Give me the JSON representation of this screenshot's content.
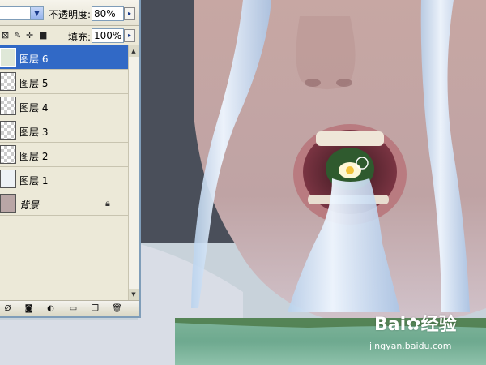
{
  "colors": {
    "panel_bg": "#ece9d8",
    "selection": "#3169c6",
    "xp_border": "#7f9db9",
    "water": "#dcecff",
    "skin": "#c9a9a2"
  },
  "options_bar": {
    "opacity_label": "不透明度:",
    "opacity_value": "80%",
    "fill_label": "填充:",
    "fill_value": "100%"
  },
  "lock_icons": [
    "transparency-lock-icon",
    "brush-lock-icon",
    "move-lock-icon",
    "all-lock-icon"
  ],
  "layers": [
    {
      "label": "图层 6",
      "selected": true
    },
    {
      "label": "图层 5",
      "selected": false
    },
    {
      "label": "图层 4",
      "selected": false
    },
    {
      "label": "图层 3",
      "selected": false
    },
    {
      "label": "图层 2",
      "selected": false
    },
    {
      "label": "图层 1",
      "selected": false
    },
    {
      "label": "背景",
      "selected": false,
      "locked": true
    }
  ],
  "bottom_icons": [
    "link-layers-icon",
    "layer-mask-icon",
    "adjustment-layer-icon",
    "new-group-icon",
    "new-layer-icon",
    "delete-layer-icon"
  ],
  "watermark": {
    "brand": "Bai",
    "brand_suffix": "经验",
    "url": "jingyan.baidu.com"
  }
}
